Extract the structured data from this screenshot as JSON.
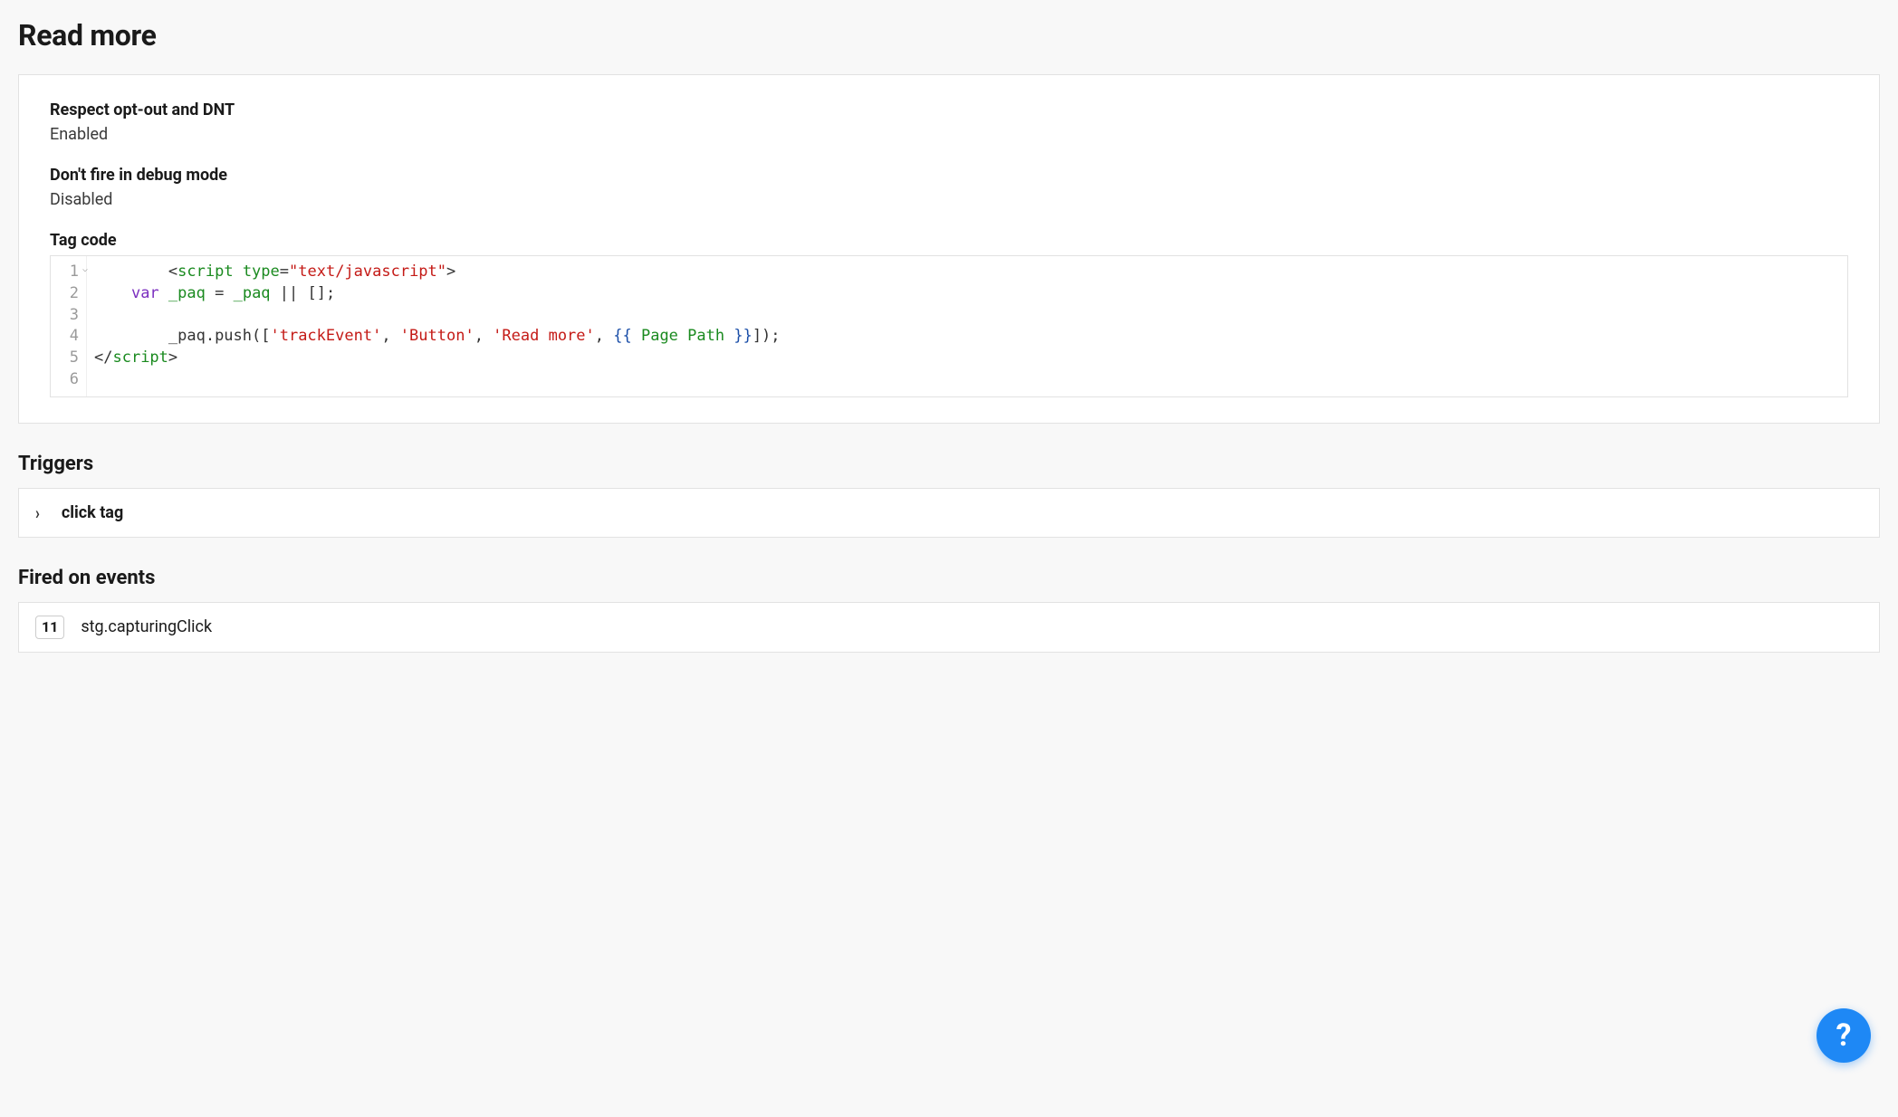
{
  "page": {
    "title": "Read more"
  },
  "settings": {
    "opt_out": {
      "label": "Respect opt-out and DNT",
      "value": "Enabled"
    },
    "debug_mode": {
      "label": "Don't fire in debug mode",
      "value": "Disabled"
    },
    "tag_code_label": "Tag code"
  },
  "code": {
    "lines": [
      "1",
      "2",
      "3",
      "4",
      "5",
      "6"
    ],
    "l1": {
      "lt": "<",
      "tag": "script",
      "sp": " ",
      "attr": "type",
      "eq": "=",
      "str": "\"text/javascript\"",
      "gt": ">"
    },
    "l2": {
      "kw": "var",
      "sp1": " ",
      "v1": "_paq",
      "mid": " = ",
      "v2": "_paq",
      "rest": " || [];"
    },
    "l4": {
      "pre": "_paq.push([",
      "s1": "'trackEvent'",
      "c1": ", ",
      "s2": "'Button'",
      "c2": ", ",
      "s3": "'Read more'",
      "c3": ", ",
      "tpl_o": "{{ ",
      "tpl_n": "Page Path",
      "tpl_c": " }}",
      "post": "]);"
    },
    "l5": {
      "lt": "</",
      "tag": "script",
      "gt": ">"
    }
  },
  "triggers": {
    "heading": "Triggers",
    "items": [
      {
        "name": "click tag"
      }
    ]
  },
  "events": {
    "heading": "Fired on events",
    "items": [
      {
        "id": "11",
        "name": "stg.capturingClick"
      }
    ]
  },
  "help": {
    "label": "?"
  }
}
